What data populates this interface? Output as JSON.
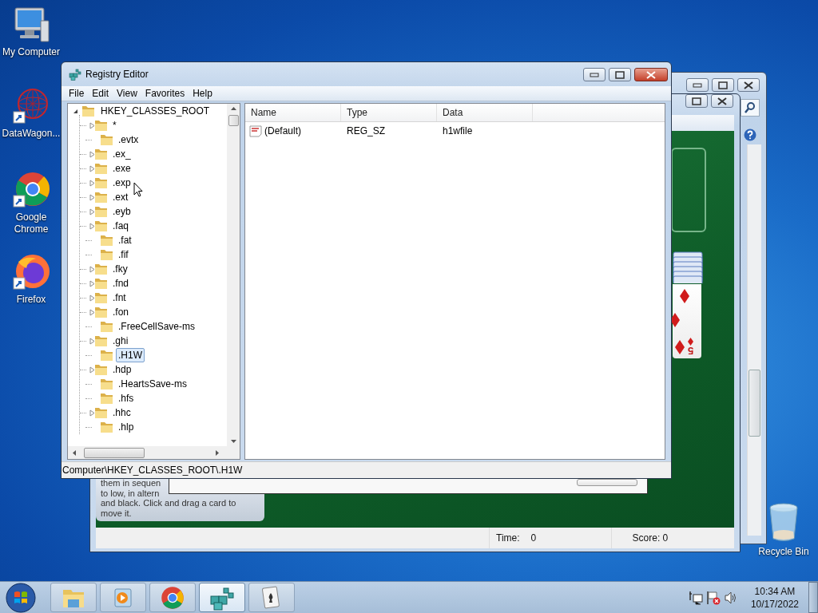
{
  "desktop_icons": [
    {
      "kind": "computer",
      "label": "My Computer"
    },
    {
      "kind": "mesh",
      "label": "DataWagon..."
    },
    {
      "kind": "chrome",
      "label": "Google Chrome"
    },
    {
      "kind": "firefox",
      "label": "Firefox"
    },
    {
      "kind": "recycle",
      "label": "Recycle Bin"
    }
  ],
  "solitaire": {
    "card": {
      "rank": "5"
    },
    "hint_lines": [
      "them in sequen",
      "to low, in altern",
      "and black. Click and drag a card to",
      "move it."
    ],
    "status": {
      "time_label": "Time:",
      "time": "0",
      "score": "Score: 0"
    }
  },
  "registry_editor": {
    "title": "Registry Editor",
    "menu": [
      "File",
      "Edit",
      "View",
      "Favorites",
      "Help"
    ],
    "tree": {
      "label": "HKEY_CLASSES_ROOT",
      "expanded": true,
      "selected": false,
      "children": [
        {
          "label": "*",
          "expandable": true,
          "selected": false
        },
        {
          "label": ".evtx",
          "expandable": false,
          "selected": false
        },
        {
          "label": ".ex_",
          "expandable": true,
          "selected": false
        },
        {
          "label": ".exe",
          "expandable": true,
          "selected": false
        },
        {
          "label": ".exp",
          "expandable": true,
          "selected": false
        },
        {
          "label": ".ext",
          "expandable": true,
          "selected": false
        },
        {
          "label": ".eyb",
          "expandable": true,
          "selected": false
        },
        {
          "label": ".faq",
          "expandable": true,
          "selected": false
        },
        {
          "label": ".fat",
          "expandable": false,
          "selected": false
        },
        {
          "label": ".fif",
          "expandable": false,
          "selected": false
        },
        {
          "label": ".fky",
          "expandable": true,
          "selected": false
        },
        {
          "label": ".fnd",
          "expandable": true,
          "selected": false
        },
        {
          "label": ".fnt",
          "expandable": true,
          "selected": false
        },
        {
          "label": ".fon",
          "expandable": true,
          "selected": false
        },
        {
          "label": ".FreeCellSave-ms",
          "expandable": false,
          "selected": false
        },
        {
          "label": ".ghi",
          "expandable": true,
          "selected": false
        },
        {
          "label": ".H1W",
          "expandable": false,
          "selected": true
        },
        {
          "label": ".hdp",
          "expandable": true,
          "selected": false
        },
        {
          "label": ".HeartsSave-ms",
          "expandable": false,
          "selected": false
        },
        {
          "label": ".hfs",
          "expandable": false,
          "selected": false
        },
        {
          "label": ".hhc",
          "expandable": true,
          "selected": false
        },
        {
          "label": ".hlp",
          "expandable": false,
          "selected": false
        }
      ]
    },
    "columns": [
      "Name",
      "Type",
      "Data"
    ],
    "values": [
      {
        "name": "(Default)",
        "type": "REG_SZ",
        "data": "h1wfile"
      }
    ],
    "status_bar": "Computer\\HKEY_CLASSES_ROOT\\.H1W"
  },
  "taskbar": {
    "items": [
      {
        "kind": "explorer",
        "selected": false
      },
      {
        "kind": "media",
        "selected": false
      },
      {
        "kind": "chrome",
        "selected": false
      },
      {
        "kind": "registry",
        "selected": true
      },
      {
        "kind": "cards",
        "selected": false
      }
    ],
    "clock": {
      "time": "10:34 AM",
      "date": "10/17/2022"
    }
  }
}
